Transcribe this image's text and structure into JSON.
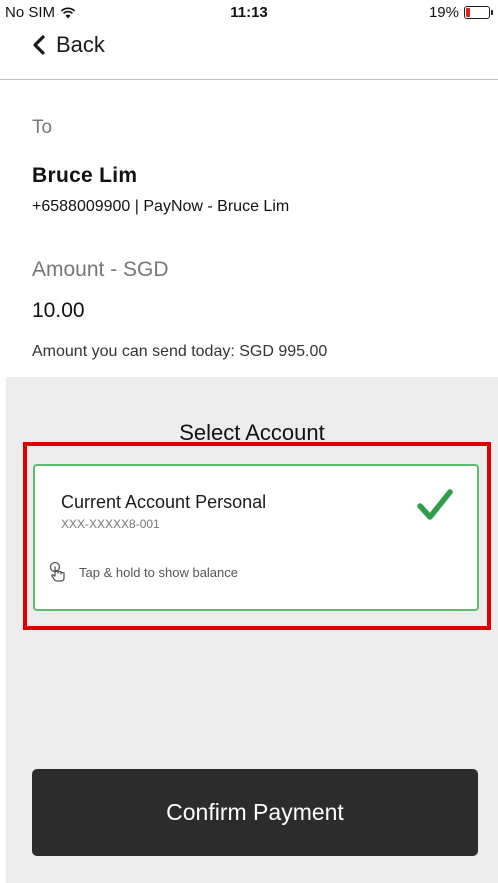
{
  "status_bar": {
    "carrier": "No SIM",
    "time": "11:13",
    "battery_percent_text": "19%",
    "battery_level": 0.19,
    "battery_color": "#e0201b"
  },
  "nav": {
    "back_label": "Back"
  },
  "transfer": {
    "to_label": "To",
    "recipient_name": "Bruce  Lim",
    "recipient_detail": "+6588009900 | PayNow -  Bruce Lim",
    "amount_label": "Amount - SGD",
    "amount_value": "10.00",
    "daily_limit_text": "Amount you can send today: SGD 995.00"
  },
  "account_selection": {
    "title": "Select Account",
    "selected_account": {
      "name": "Current Account Personal",
      "number": "XXX-XXXXX8-001",
      "hint": "Tap & hold to show balance",
      "selected": true,
      "icon": "checkmark-icon"
    },
    "highlight_color": "#e00000",
    "card_border_color": "#5cbf70"
  },
  "actions": {
    "confirm_label": "Confirm Payment"
  }
}
